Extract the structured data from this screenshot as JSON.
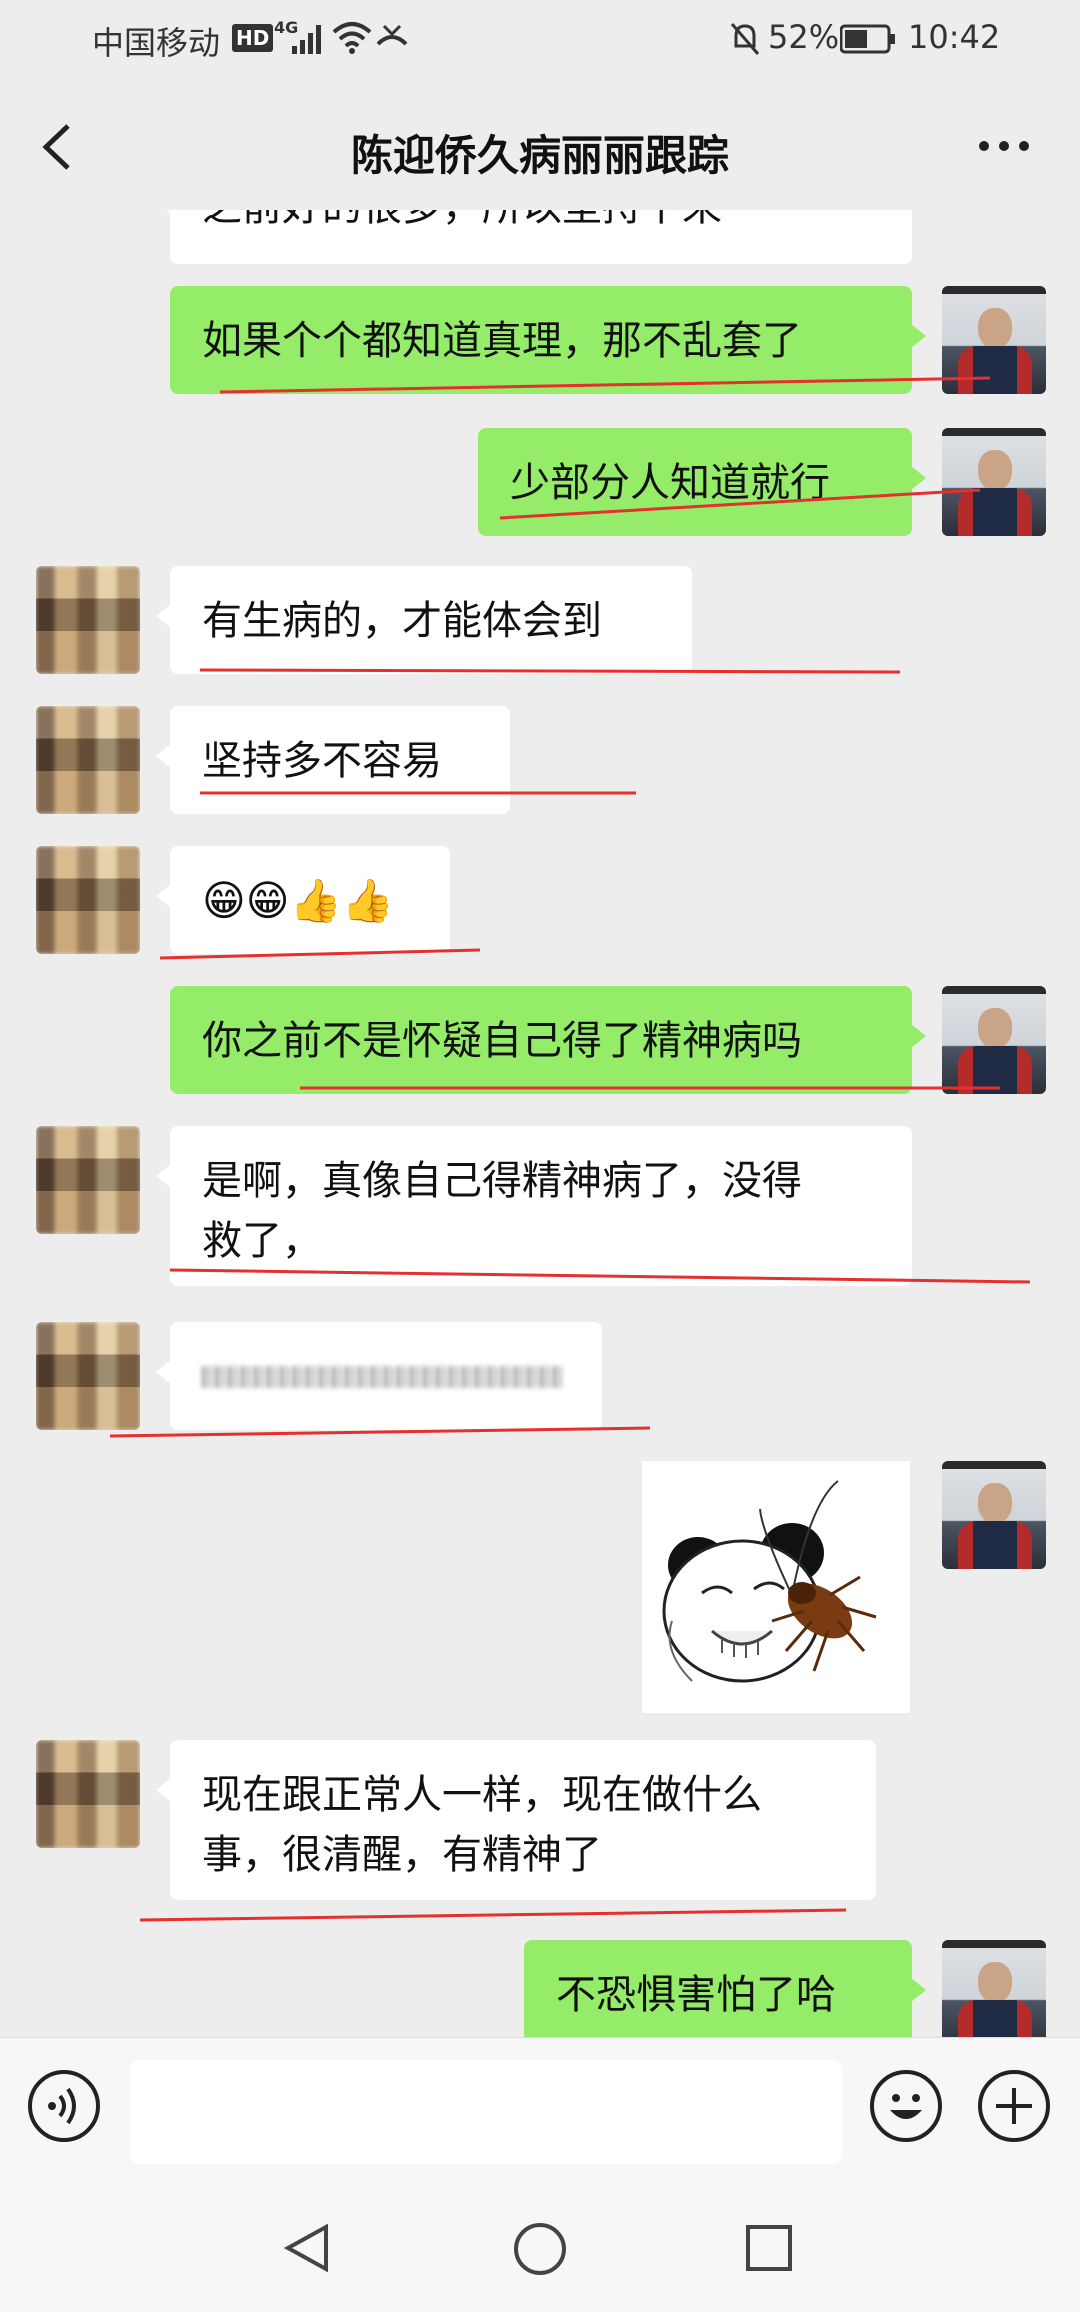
{
  "status_bar": {
    "carrier": "中国移动",
    "hd_badge": "HD",
    "network": "4G",
    "battery_percent": "52%",
    "time": "10:42"
  },
  "header": {
    "title": "陈迎侨久病丽丽跟踪"
  },
  "messages": [
    {
      "side": "right",
      "type": "text",
      "text": "之前好的很多，所以坚持下来"
    },
    {
      "side": "right",
      "type": "text",
      "text": "如果个个都知道真理，那不乱套了"
    },
    {
      "side": "right",
      "type": "text",
      "text": "少部分人知道就行"
    },
    {
      "side": "left",
      "type": "text",
      "text": "有生病的，才能体会到"
    },
    {
      "side": "left",
      "type": "text",
      "text": "坚持多不容易"
    },
    {
      "side": "left",
      "type": "emoji",
      "text": "😁😁👍👍"
    },
    {
      "side": "right",
      "type": "text",
      "text": "你之前不是怀疑自己得了精神病吗"
    },
    {
      "side": "left",
      "type": "text",
      "line1": "是啊，真像自己得精神病了，没得",
      "line2": "救了，"
    },
    {
      "side": "left",
      "type": "blurred",
      "text": ""
    },
    {
      "side": "right",
      "type": "sticker",
      "sticker": "panda-cockroach-sticker"
    },
    {
      "side": "left",
      "type": "text",
      "line1": "现在跟正常人一样，现在做什么",
      "line2": "事，很清醒，有精神了"
    },
    {
      "side": "right",
      "type": "text",
      "text": "不恐惧害怕了哈"
    }
  ],
  "input": {
    "value": "",
    "placeholder": ""
  },
  "icons": {
    "back": "chevron-left-icon",
    "more": "more-dots-icon",
    "voice": "voice-icon",
    "emoji": "emoji-icon",
    "add": "plus-icon",
    "nav_back": "triangle-back-icon",
    "nav_home": "circle-home-icon",
    "nav_recent": "square-recent-icon"
  },
  "colors": {
    "background": "#ededed",
    "bubble_sent": "#95ec69",
    "bubble_received": "#ffffff",
    "annotation_line": "#e53030"
  }
}
